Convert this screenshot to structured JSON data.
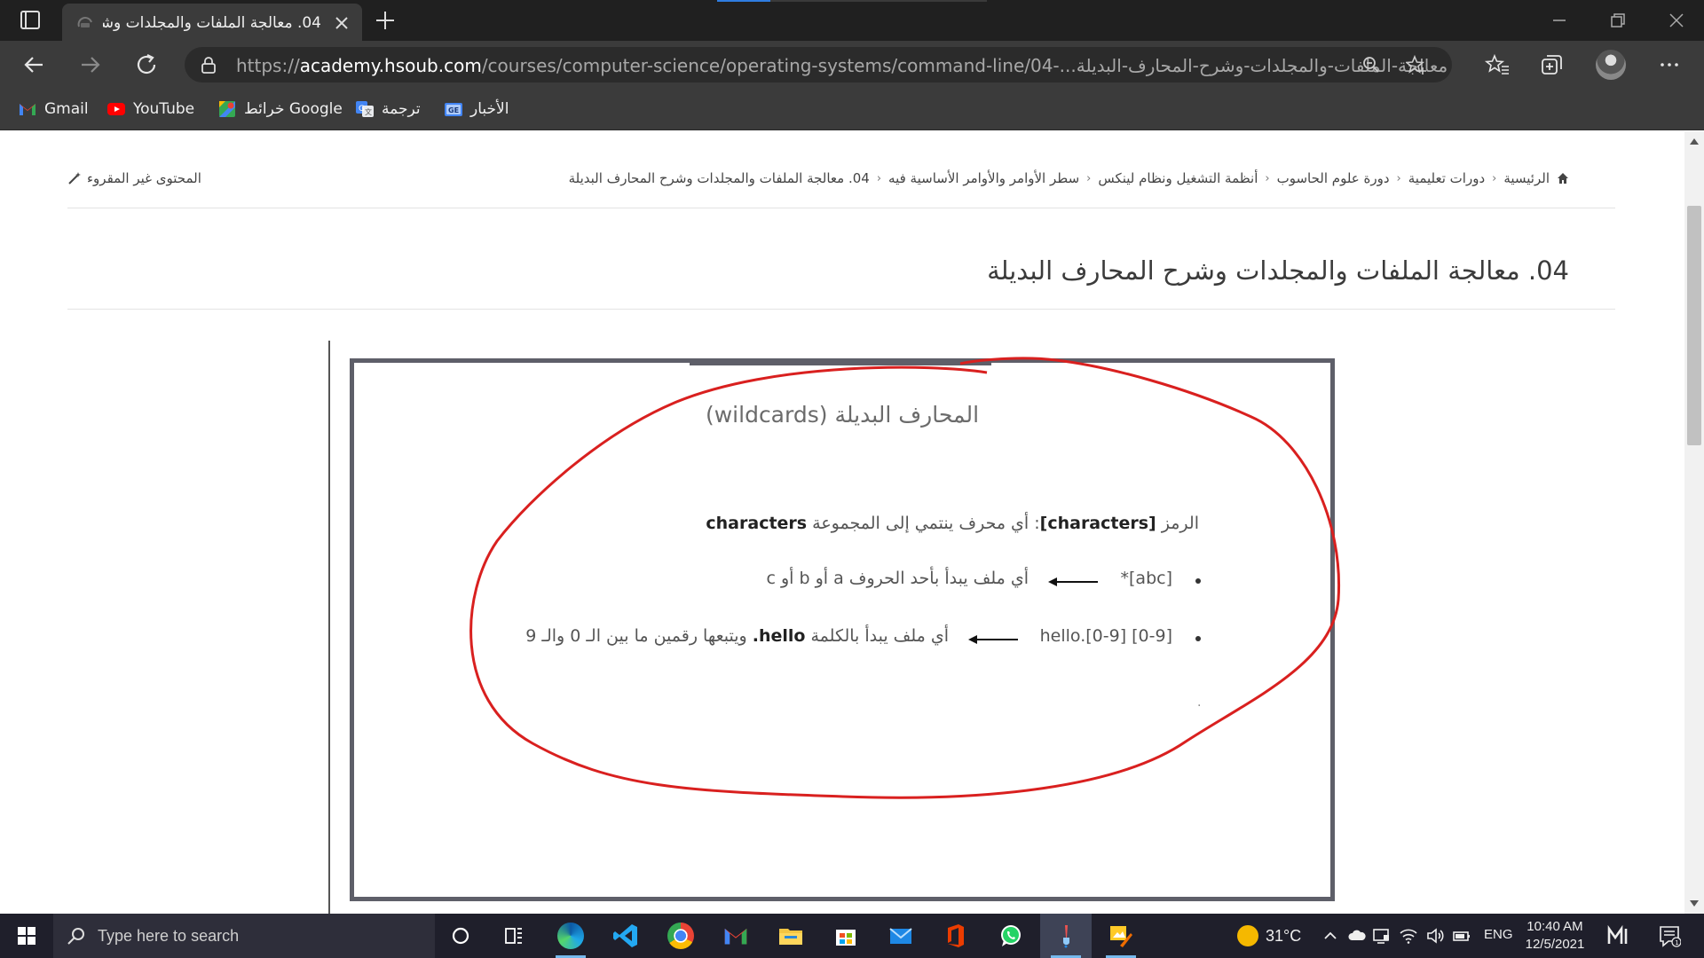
{
  "browser": {
    "tab_title": "04. معالجة الملفات والمجلدات وشرح المحارف البديلة",
    "url_scheme": "https://",
    "url_host": "academy.hsoub.com",
    "url_path": "/courses/computer-science/operating-systems/command-line/04-...معالجة-الملفات-والمجلدات-وشرح-المحارف-البديلة",
    "bookmarks": [
      {
        "label": "Gmail",
        "icon": "gmail-icon"
      },
      {
        "label": "YouTube",
        "icon": "youtube-icon"
      },
      {
        "label": "خرائط Google",
        "icon": "maps-icon"
      },
      {
        "label": "ترجمة",
        "icon": "translate-icon"
      },
      {
        "label": "الأخبار",
        "icon": "news-icon"
      }
    ]
  },
  "page": {
    "breadcrumb": [
      "الرئيسية",
      "دورات تعليمية",
      "دورة علوم الحاسوب",
      "أنظمة التشغيل ونظام لينكس",
      "سطر الأوامر والأوامر الأساسية فيه",
      "04. معالجة الملفات والمجلدات وشرح المحارف البديلة"
    ],
    "unread_label": "المحتوى غير المقروء",
    "title": "04. معالجة الملفات والمجلدات وشرح المحارف البديلة",
    "annotation_color": "#d9201f"
  },
  "slide": {
    "title": "المحارف البديلة (wildcards)",
    "intro_prefix": "الرمز ",
    "intro_symbol": "[characters]",
    "intro_middle": ": أي محرف ينتمي إلى المجموعة ",
    "intro_set": "characters",
    "bullets": [
      {
        "code": "[abc]*",
        "desc_a": "أي ملف يبدأ بأحد الحروف  a أو b أو c",
        "bold": "",
        "desc_b": ""
      },
      {
        "code": "hello.[0-9] [0-9]",
        "desc_a": "أي ملف يبدأ بالكلمة  ",
        "bold": "hello.",
        "desc_b": " ويتبعها رقمين ما بين الـ 0  والـ 9"
      }
    ],
    "trailing_dot": "."
  },
  "taskbar": {
    "search_placeholder": "Type here to search",
    "temperature": "31°C",
    "language": "ENG",
    "time": "10:40 AM",
    "date": "12/5/2021",
    "apps": [
      "task-view",
      "edge",
      "vscode",
      "chrome",
      "gmail",
      "file-explorer",
      "store",
      "mail",
      "office",
      "whatsapp",
      "paint-app",
      "photos"
    ]
  }
}
